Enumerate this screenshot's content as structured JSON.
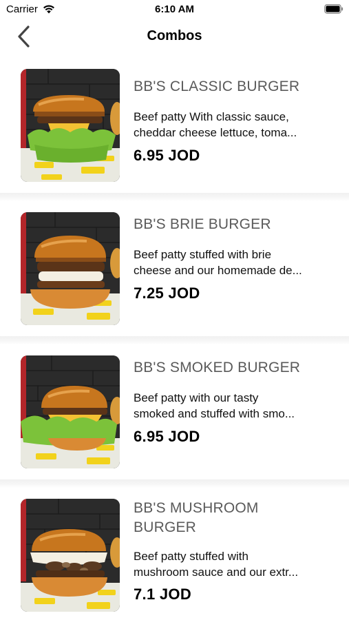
{
  "status_bar": {
    "carrier": "Carrier",
    "time": "6:10 AM",
    "wifi_icon": "wifi-icon",
    "battery_icon": "battery-icon"
  },
  "nav": {
    "title": "Combos",
    "back_icon": "chevron-left-icon"
  },
  "items": [
    {
      "name": "BB'S CLASSIC BURGER",
      "desc_line1": "Beef patty With classic sauce,",
      "desc_line2": "cheddar cheese lettuce, toma...",
      "price": "6.95 JOD"
    },
    {
      "name": "BB'S BRIE BURGER",
      "desc_line1": "Beef patty stuffed with brie",
      "desc_line2": "cheese and our homemade de...",
      "price": "7.25 JOD"
    },
    {
      "name": "BB'S SMOKED BURGER",
      "desc_line1": "Beef patty with our tasty",
      "desc_line2": "smoked and stuffed with smo...",
      "price": "6.95 JOD"
    },
    {
      "name_line1": "BB'S MUSHROOM",
      "name_line2": "BURGER",
      "desc_line1": "Beef patty stuffed with",
      "desc_line2": "mushroom sauce and our extr...",
      "price": "7.1 JOD"
    }
  ],
  "colors": {
    "name_text": "#5a5a5a",
    "price_text": "#000000",
    "brand_yellow": "#f2d21b"
  }
}
